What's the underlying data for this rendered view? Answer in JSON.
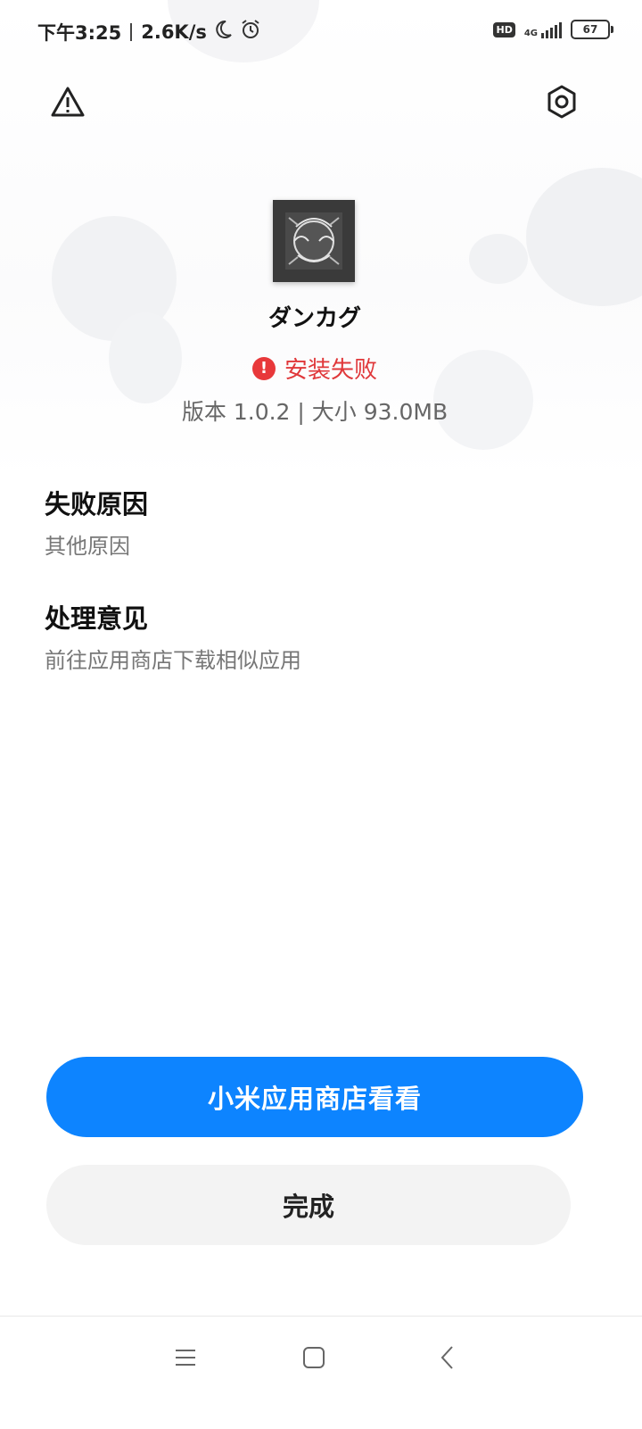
{
  "status_bar": {
    "time": "下午3:25",
    "network_speed": "2.6K/s",
    "hd_label": "HD",
    "network_type": "4G",
    "battery_level": "67",
    "icons": [
      "moon-icon",
      "alarm-icon",
      "signal-icon",
      "battery-icon"
    ]
  },
  "top_actions": {
    "left_icon": "warning-icon",
    "right_icon": "settings-icon"
  },
  "app": {
    "name": "ダンカグ",
    "install_status": "安装失败",
    "meta": "版本 1.0.2 | 大小 93.0MB",
    "status_color": "#e0383a"
  },
  "failure": {
    "title": "失败原因",
    "reason": "其他原因"
  },
  "suggestion": {
    "title": "处理意见",
    "text": "前往应用商店下载相似应用"
  },
  "buttons": {
    "store": "小米应用商店看看",
    "done": "完成"
  },
  "colors": {
    "accent": "#0d84ff",
    "error": "#e8383a"
  },
  "nav": [
    "menu-icon",
    "home-icon",
    "back-icon"
  ]
}
